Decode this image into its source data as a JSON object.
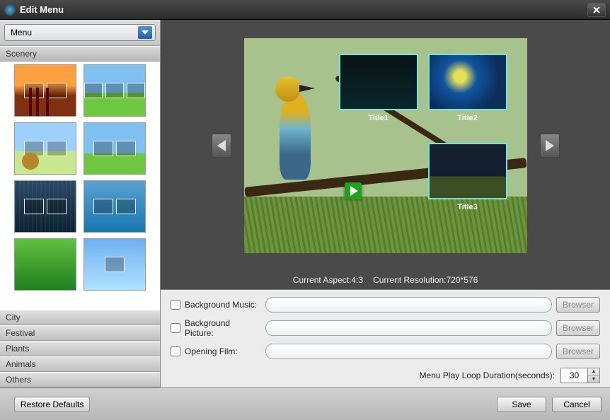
{
  "window": {
    "title": "Edit Menu"
  },
  "menu_combo": {
    "value": "Menu"
  },
  "categories": [
    "Scenery",
    "City",
    "Festival",
    "Plants",
    "Animals",
    "Others"
  ],
  "active_category": "Scenery",
  "preview": {
    "titles": [
      "Title1",
      "Title2",
      "Title3"
    ]
  },
  "info": {
    "aspect_label": "Current Aspect:",
    "aspect_value": "4:3",
    "resolution_label": "Current Resolution:",
    "resolution_value": "720*576"
  },
  "fields": {
    "bg_music": {
      "label": "Background Music:",
      "value": "",
      "browse": "Browser"
    },
    "bg_picture": {
      "label": "Background Picture:",
      "value": "",
      "browse": "Browser"
    },
    "opening_film": {
      "label": "Opening Film:",
      "value": "",
      "browse": "Browser"
    }
  },
  "loop": {
    "label": "Menu Play Loop Duration(seconds):",
    "value": "30"
  },
  "buttons": {
    "restore": "Restore Defaults",
    "save": "Save",
    "cancel": "Cancel"
  }
}
